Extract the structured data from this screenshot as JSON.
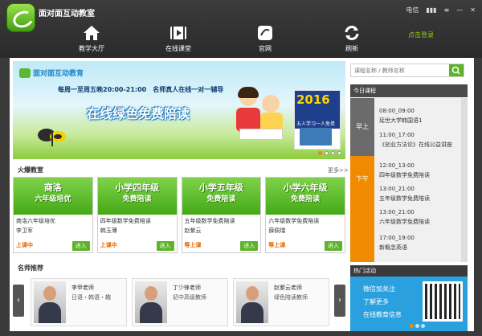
{
  "app": {
    "title": "面对面互动教室"
  },
  "window": {
    "signal": "电信",
    "minimize": "—",
    "close": "✕"
  },
  "nav": [
    {
      "label": "教学大厅",
      "icon": "home-icon"
    },
    {
      "label": "在线课堂",
      "icon": "video-icon"
    },
    {
      "label": "官网",
      "icon": "web-icon"
    },
    {
      "label": "刷新",
      "icon": "refresh-icon"
    }
  ],
  "login": "点击登录",
  "banner": {
    "brand": "面对面互动教育",
    "schedule": "每周一至周五晚20:00-21:00",
    "slogan": "名师真人在线一对一辅导",
    "headline": "在线绿色免费陪读",
    "ad_year": "2016",
    "ad_sub": "五人学习一人免单"
  },
  "hot_classes": {
    "title": "火爆教室",
    "more": "更多>>",
    "items": [
      {
        "img_line1": "商洛",
        "img_line2": "六年级培优",
        "name": "商洛六年级培优",
        "teacher": "李卫军",
        "status": "上课中",
        "enter": "进入"
      },
      {
        "img_line1": "小学四年级",
        "img_line2": "免费陪读",
        "name": "四年级数学免费陪读",
        "teacher": "韩玉薄",
        "status": "上课中",
        "enter": "进入"
      },
      {
        "img_line1": "小学五年级",
        "img_line2": "免费陪读",
        "name": "五年级数学免费陪读",
        "teacher": "赵紫云",
        "status": "等上课",
        "enter": "进入"
      },
      {
        "img_line1": "小学六年级",
        "img_line2": "免费陪读",
        "name": "六年级数学免费陪读",
        "teacher": "薛佩瑞",
        "status": "等上课",
        "enter": "进入"
      }
    ]
  },
  "teachers": {
    "title": "名师推荐",
    "items": [
      {
        "name": "李甲老师",
        "desc": "日语・韩语・趣"
      },
      {
        "name": "丁少锋老师",
        "desc": "初中高级教师"
      },
      {
        "name": "赵紫云老师",
        "desc": "绿色陪读教师"
      }
    ]
  },
  "search": {
    "placeholder": "课程名称 / 教师名称"
  },
  "today": {
    "title": "今日课程",
    "morning_label": "早上",
    "afternoon_label": "下午",
    "slots": [
      {
        "time": "08:00_09:00",
        "name": "延世大学韩国语1"
      },
      {
        "time": "11:00_17:00",
        "name": "《创业方法论》在线公益讲座"
      },
      {
        "time": "12:00_13:00",
        "name": "四年级数学免费陪读"
      },
      {
        "time": "13:00_21:00",
        "name": "五年级数学免费陪读"
      },
      {
        "time": "13:00_21:00",
        "name": "六年级数学免费陪读"
      },
      {
        "time": "17:00_19:00",
        "name": "新概念英语"
      }
    ]
  },
  "activity": {
    "title": "热门活动",
    "line1": "微信加关注",
    "line2": "了解更多",
    "line3": "在线教育信息"
  },
  "colors": {
    "accent": "#5db32a",
    "orange": "#f08a00",
    "blue": "#2aa0df"
  }
}
